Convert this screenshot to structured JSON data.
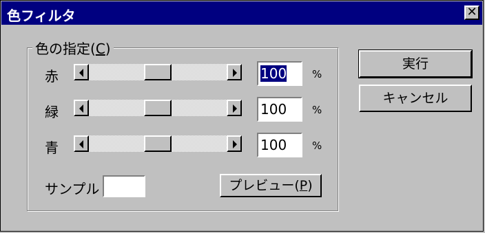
{
  "window": {
    "title": "色フィルタ",
    "close_glyph": "✕"
  },
  "group": {
    "legend_prefix": "色の指定(",
    "legend_access": "C",
    "legend_suffix": ")"
  },
  "rows": [
    {
      "label": "赤",
      "value": "100",
      "unit": "%",
      "level": 0.5
    },
    {
      "label": "緑",
      "value": "100",
      "unit": "%",
      "level": 0.5
    },
    {
      "label": "青",
      "value": "100",
      "unit": "%",
      "level": 0.5
    }
  ],
  "sample": {
    "label": "サンプル",
    "color": "#ffffff"
  },
  "buttons": {
    "execute": "実行",
    "cancel": "キャンセル",
    "preview_prefix": "プレビュー(",
    "preview_access": "P",
    "preview_suffix": ")"
  },
  "icons": {
    "left": "arrow-left-icon",
    "right": "arrow-right-icon",
    "close": "close-icon"
  },
  "colors": {
    "titlebar": "#000080",
    "face": "#c0c0c0",
    "selection": "#000080"
  }
}
